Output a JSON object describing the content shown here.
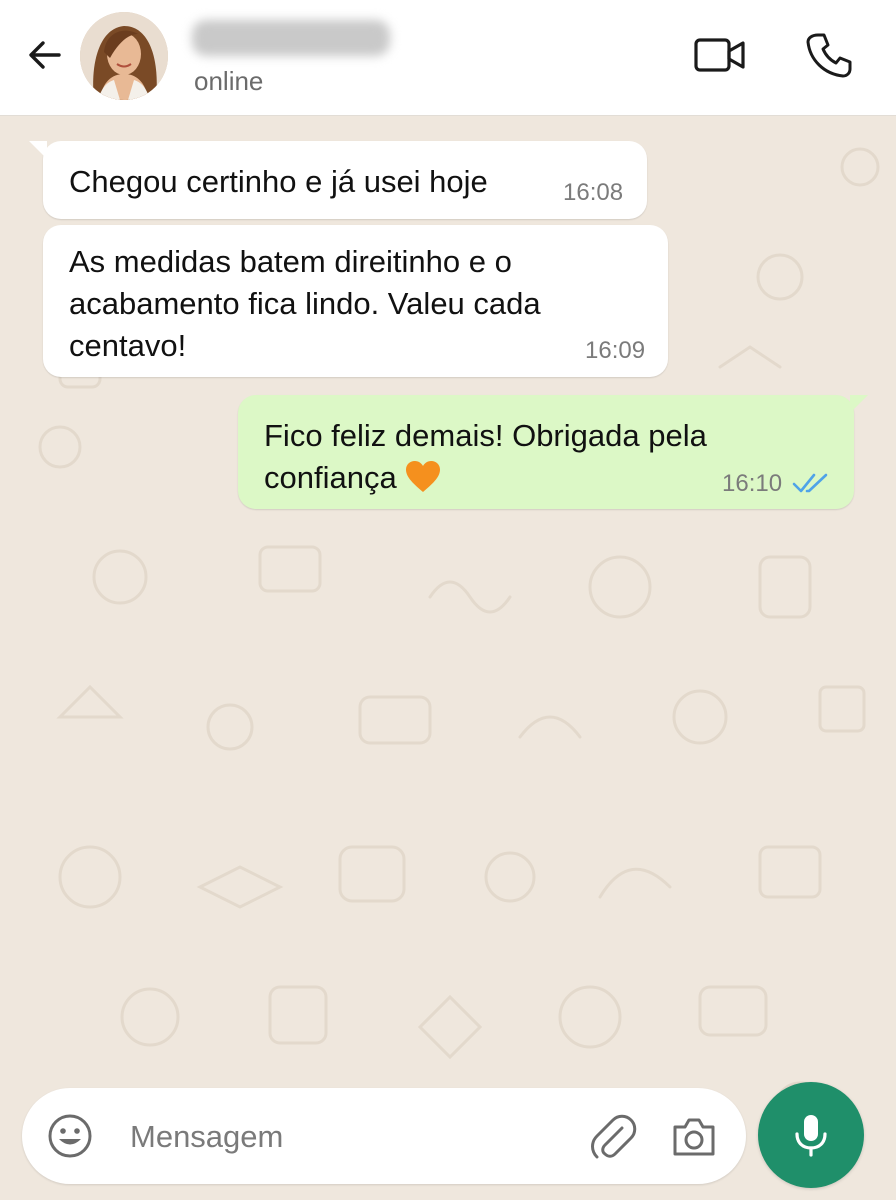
{
  "header": {
    "back_icon": "arrow-left-icon",
    "contact_status": "online",
    "video_icon": "video-camera-icon",
    "call_icon": "phone-icon"
  },
  "messages": [
    {
      "direction": "incoming",
      "text": "Chegou certinho e já usei hoje",
      "time": "16:08"
    },
    {
      "direction": "incoming",
      "text": "As medidas batem direitinho e o acabamento fica lindo. Valeu cada centavo!",
      "time": "16:09"
    },
    {
      "direction": "outgoing",
      "text": "Fico feliz demais! Obrigada pela confiança",
      "emoji": "orange-heart",
      "time": "16:10",
      "status": "read"
    }
  ],
  "input": {
    "placeholder": "Mensagem",
    "emoji_icon": "emoji-icon",
    "attach_icon": "paperclip-icon",
    "camera_icon": "camera-icon",
    "mic_icon": "microphone-icon"
  },
  "colors": {
    "outgoing_bubble": "#dcf8c6",
    "incoming_bubble": "#ffffff",
    "wallpaper": "#efe7dd",
    "accent": "#1f8f6a",
    "read_ticks": "#4fa3e8"
  }
}
